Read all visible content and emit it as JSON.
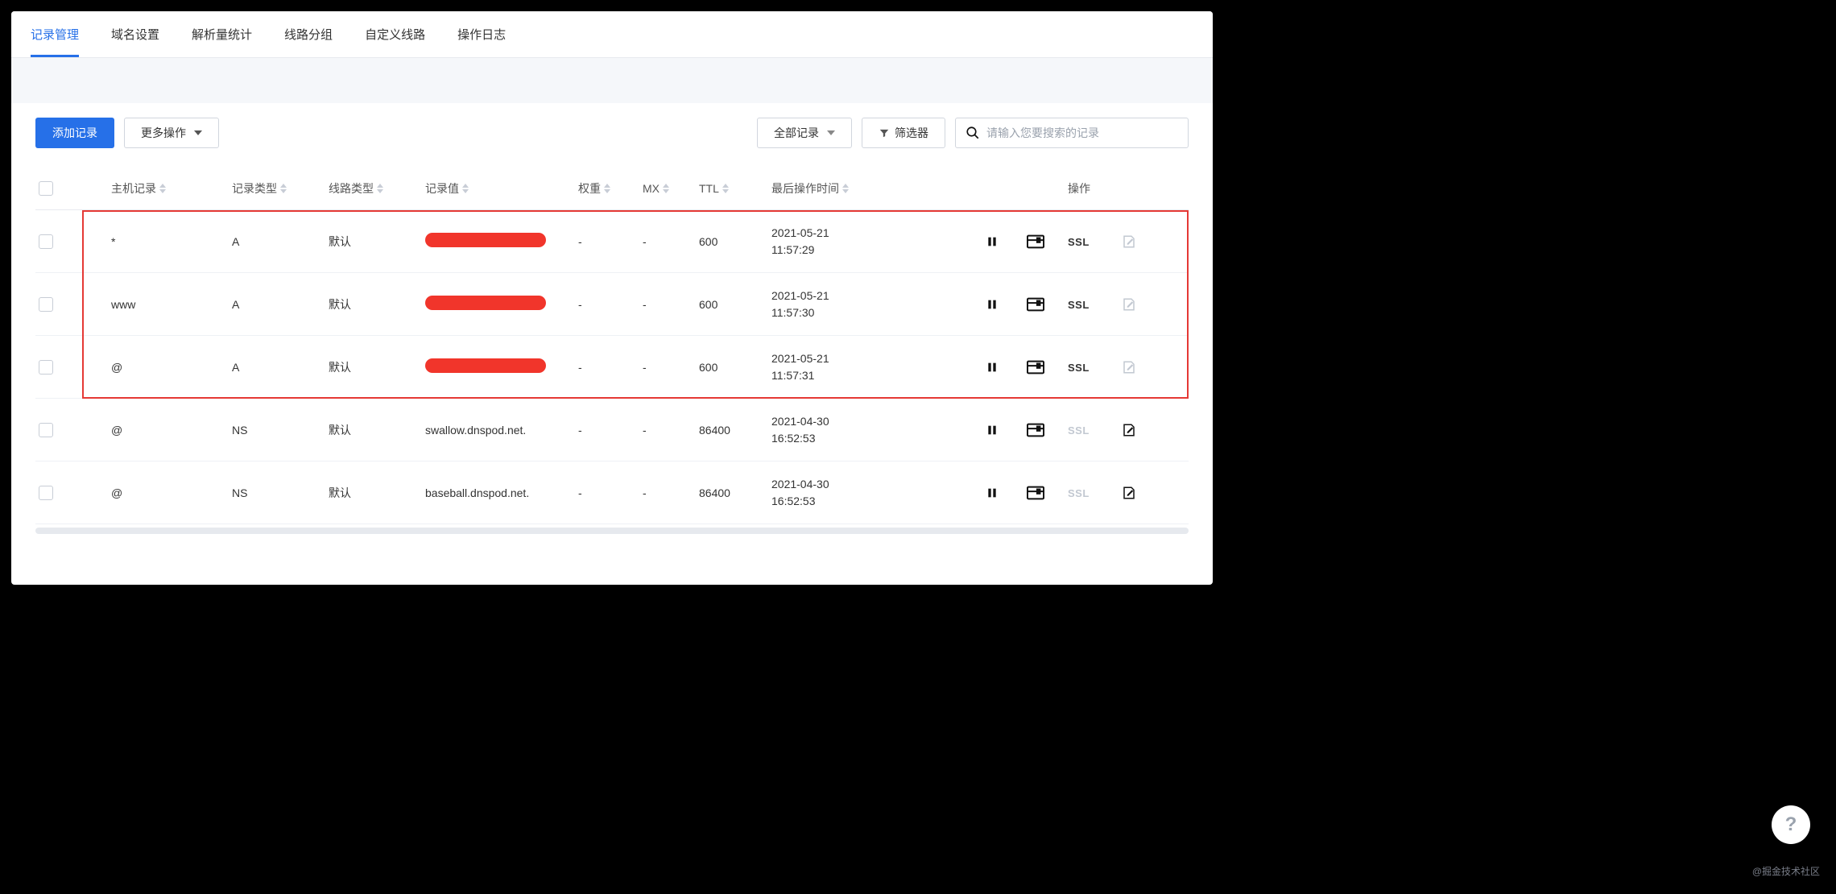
{
  "tabs": [
    {
      "label": "记录管理",
      "active": true
    },
    {
      "label": "域名设置",
      "active": false
    },
    {
      "label": "解析量统计",
      "active": false
    },
    {
      "label": "线路分组",
      "active": false
    },
    {
      "label": "自定义线路",
      "active": false
    },
    {
      "label": "操作日志",
      "active": false
    }
  ],
  "toolbar": {
    "add_label": "添加记录",
    "more_label": "更多操作",
    "all_records_label": "全部记录",
    "filter_label": "筛选器",
    "search_placeholder": "请输入您要搜索的记录"
  },
  "columns": {
    "host": "主机记录",
    "type": "记录类型",
    "line": "线路类型",
    "value": "记录值",
    "weight": "权重",
    "mx": "MX",
    "ttl": "TTL",
    "last_op": "最后操作时间",
    "actions": "操作"
  },
  "rows": [
    {
      "status": "on",
      "host": "*",
      "type": "A",
      "line": "默认",
      "value": "[REDACTED]",
      "redacted": true,
      "weight": "-",
      "mx": "-",
      "ttl": "600",
      "date": "2021-05-21",
      "time": "11:57:29",
      "ssl_enabled": true
    },
    {
      "status": "on",
      "host": "www",
      "type": "A",
      "line": "默认",
      "value": "[REDACTED]",
      "redacted": true,
      "weight": "-",
      "mx": "-",
      "ttl": "600",
      "date": "2021-05-21",
      "time": "11:57:30",
      "ssl_enabled": true
    },
    {
      "status": "on",
      "host": "@",
      "type": "A",
      "line": "默认",
      "value": "[REDACTED]",
      "redacted": true,
      "weight": "-",
      "mx": "-",
      "ttl": "600",
      "date": "2021-05-21",
      "time": "11:57:31",
      "ssl_enabled": true
    },
    {
      "status": "on",
      "host": "@",
      "type": "NS",
      "line": "默认",
      "value": "swallow.dnspod.net.",
      "redacted": false,
      "weight": "-",
      "mx": "-",
      "ttl": "86400",
      "date": "2021-04-30",
      "time": "16:52:53",
      "ssl_enabled": false
    },
    {
      "status": "on",
      "host": "@",
      "type": "NS",
      "line": "默认",
      "value": "baseball.dnspod.net.",
      "redacted": false,
      "weight": "-",
      "mx": "-",
      "ttl": "86400",
      "date": "2021-04-30",
      "time": "16:52:53",
      "ssl_enabled": false
    }
  ],
  "ssl_label": "SSL",
  "watermark": "@掘金技术社区",
  "highlight_rows": [
    0,
    2
  ]
}
